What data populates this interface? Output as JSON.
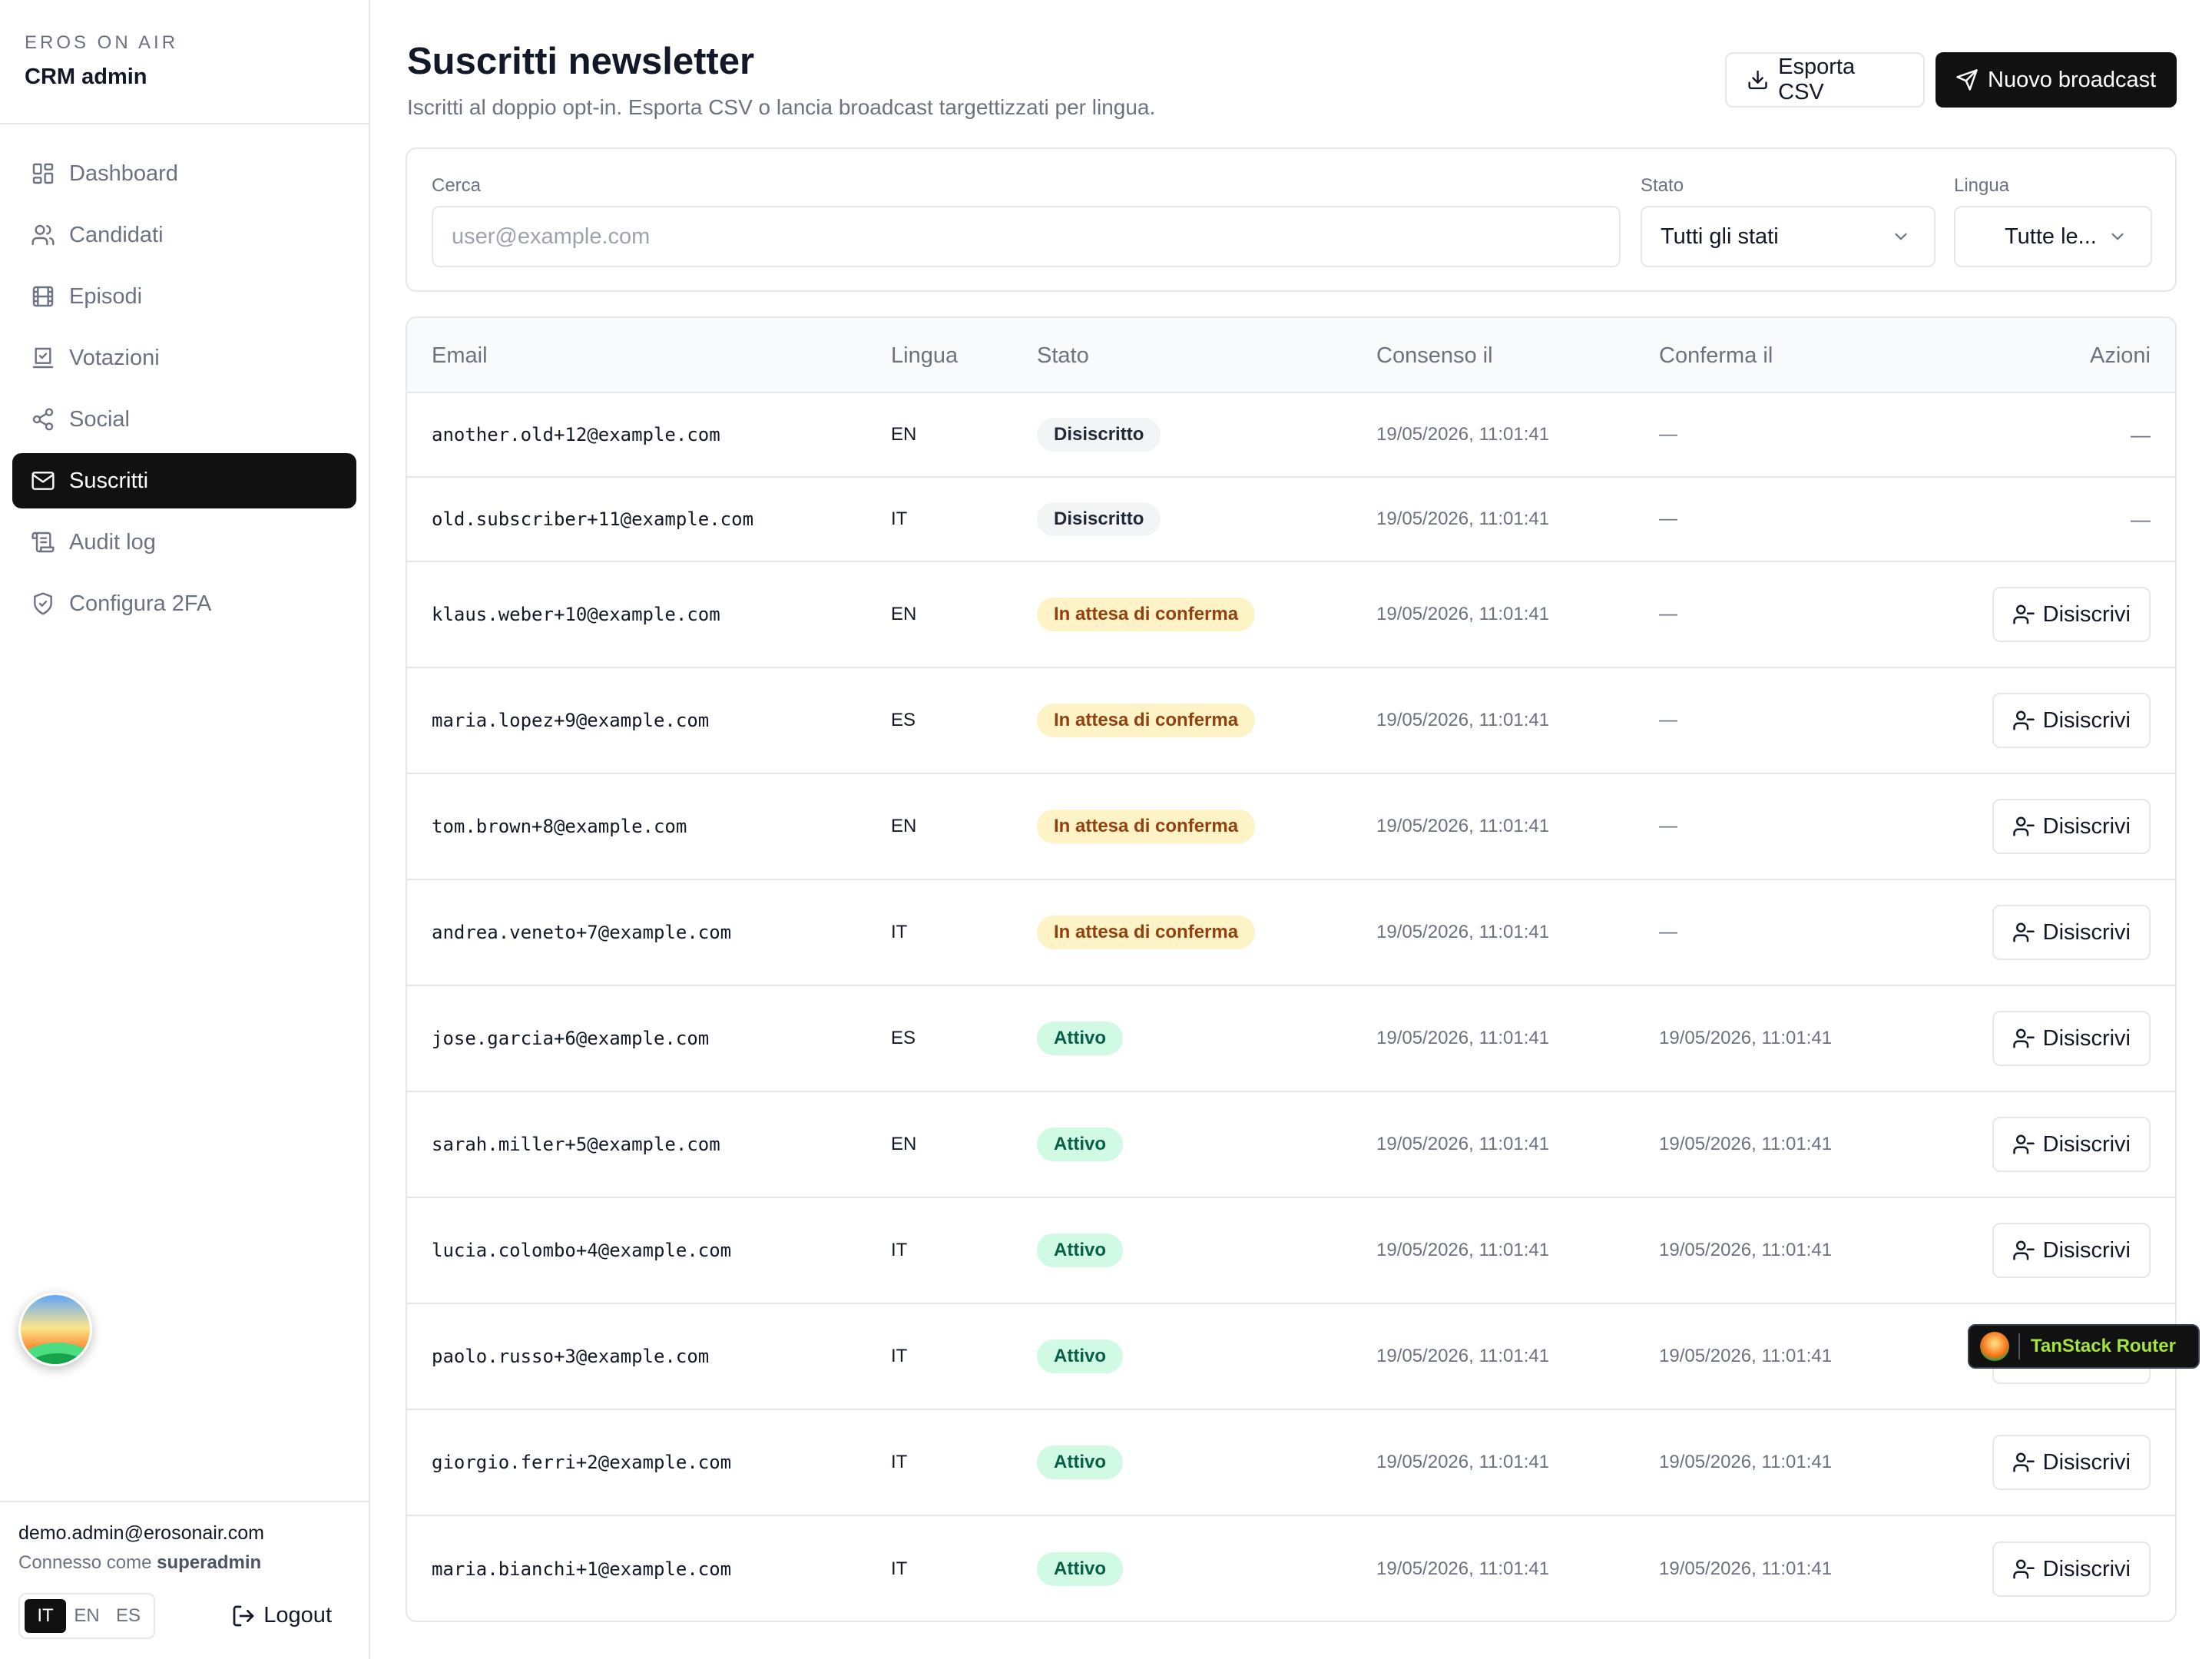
{
  "brand": {
    "top": "EROS ON AIR",
    "main": "CRM admin"
  },
  "nav": [
    {
      "label": "Dashboard",
      "icon": "dashboard-icon"
    },
    {
      "label": "Candidati",
      "icon": "users-icon"
    },
    {
      "label": "Episodi",
      "icon": "film-icon"
    },
    {
      "label": "Votazioni",
      "icon": "vote-icon"
    },
    {
      "label": "Social",
      "icon": "share-icon"
    },
    {
      "label": "Suscritti",
      "icon": "mail-icon",
      "active": true
    },
    {
      "label": "Audit log",
      "icon": "log-icon"
    },
    {
      "label": "Configura 2FA",
      "icon": "shield-icon"
    }
  ],
  "user": {
    "email": "demo.admin@erosonair.com",
    "role_prefix": "Connesso come",
    "role": "superadmin"
  },
  "languages": [
    "IT",
    "EN",
    "ES"
  ],
  "active_language": "IT",
  "logout_label": "Logout",
  "page": {
    "title": "Suscritti newsletter",
    "subtitle": "Iscritti al doppio opt-in. Esporta CSV o lancia broadcast targettizzati per lingua.",
    "export_label": "Esporta CSV",
    "broadcast_label": "Nuovo broadcast"
  },
  "filters": {
    "search_label": "Cerca",
    "search_placeholder": "user@example.com",
    "stato_label": "Stato",
    "stato_value": "Tutti gli stati",
    "lingua_label": "Lingua",
    "lingua_value": "Tutte le..."
  },
  "table": {
    "headers": [
      "Email",
      "Lingua",
      "Stato",
      "Consenso il",
      "Conferma il",
      "Azioni"
    ],
    "action_label": "Disiscrivi",
    "rows": [
      {
        "email": "another.old+12@example.com",
        "lang": "EN",
        "status": "Disiscritto",
        "kind": "gray",
        "consent": "19/05/2026, 11:01:41",
        "confirm": "—",
        "action": false
      },
      {
        "email": "old.subscriber+11@example.com",
        "lang": "IT",
        "status": "Disiscritto",
        "kind": "gray",
        "consent": "19/05/2026, 11:01:41",
        "confirm": "—",
        "action": false
      },
      {
        "email": "klaus.weber+10@example.com",
        "lang": "EN",
        "status": "In attesa di conferma",
        "kind": "amber",
        "consent": "19/05/2026, 11:01:41",
        "confirm": "—",
        "action": true
      },
      {
        "email": "maria.lopez+9@example.com",
        "lang": "ES",
        "status": "In attesa di conferma",
        "kind": "amber",
        "consent": "19/05/2026, 11:01:41",
        "confirm": "—",
        "action": true
      },
      {
        "email": "tom.brown+8@example.com",
        "lang": "EN",
        "status": "In attesa di conferma",
        "kind": "amber",
        "consent": "19/05/2026, 11:01:41",
        "confirm": "—",
        "action": true
      },
      {
        "email": "andrea.veneto+7@example.com",
        "lang": "IT",
        "status": "In attesa di conferma",
        "kind": "amber",
        "consent": "19/05/2026, 11:01:41",
        "confirm": "—",
        "action": true
      },
      {
        "email": "jose.garcia+6@example.com",
        "lang": "ES",
        "status": "Attivo",
        "kind": "green",
        "consent": "19/05/2026, 11:01:41",
        "confirm": "19/05/2026, 11:01:41",
        "action": true
      },
      {
        "email": "sarah.miller+5@example.com",
        "lang": "EN",
        "status": "Attivo",
        "kind": "green",
        "consent": "19/05/2026, 11:01:41",
        "confirm": "19/05/2026, 11:01:41",
        "action": true
      },
      {
        "email": "lucia.colombo+4@example.com",
        "lang": "IT",
        "status": "Attivo",
        "kind": "green",
        "consent": "19/05/2026, 11:01:41",
        "confirm": "19/05/2026, 11:01:41",
        "action": true
      },
      {
        "email": "paolo.russo+3@example.com",
        "lang": "IT",
        "status": "Attivo",
        "kind": "green",
        "consent": "19/05/2026, 11:01:41",
        "confirm": "19/05/2026, 11:01:41",
        "action": true
      },
      {
        "email": "giorgio.ferri+2@example.com",
        "lang": "IT",
        "status": "Attivo",
        "kind": "green",
        "consent": "19/05/2026, 11:01:41",
        "confirm": "19/05/2026, 11:01:41",
        "action": true
      },
      {
        "email": "maria.bianchi+1@example.com",
        "lang": "IT",
        "status": "Attivo",
        "kind": "green",
        "consent": "19/05/2026, 11:01:41",
        "confirm": "19/05/2026, 11:01:41",
        "action": true
      }
    ]
  },
  "devtools": {
    "label": "TanStack Router"
  },
  "colors": {
    "accent": "#111111",
    "amber_bg": "#fef3c7",
    "green_bg": "#d1fae5",
    "gray_bg": "#f3f4f6"
  }
}
